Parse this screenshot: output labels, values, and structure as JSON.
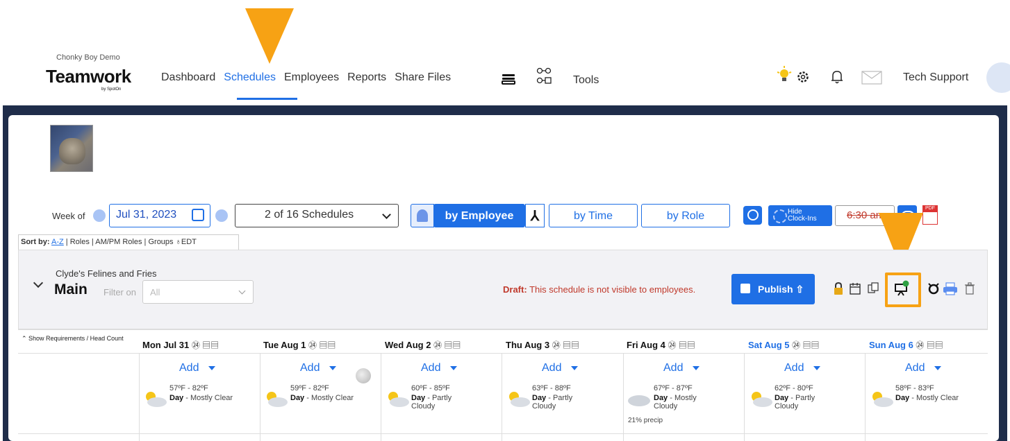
{
  "header": {
    "company": "Chonky Boy Demo",
    "brand": "Teamwork",
    "brand_sub": "by SpotOn",
    "nav": [
      "Dashboard",
      "Schedules",
      "Employees",
      "Reports",
      "Share Files"
    ],
    "active_nav": "Schedules",
    "tools_label": "Tools",
    "user_label": "Tech Support",
    "accent_color": "#1f6fe5",
    "highlight_color": "#f7a214"
  },
  "toolbar": {
    "week_of_label": "Week of",
    "week_date": "Jul 31, 2023",
    "schedules_select": "2 of 16 Schedules",
    "by_employee": "by Employee",
    "by_time": "by Time",
    "by_role": "by Role",
    "hide_clockins_line1": "Hide",
    "hide_clockins_line2": "Clock-Ins",
    "time_value": "6:30 am"
  },
  "sortbar": {
    "sort_by": "Sort by:",
    "options": [
      "A-Z",
      "Roles",
      "AM/PM Roles",
      "Groups"
    ],
    "timezone": "EDT"
  },
  "group": {
    "location": "Clyde's Felines and Fries",
    "title": "Main",
    "filter_label": "Filter on",
    "filter_value": "All",
    "draft_label": "Draft:",
    "draft_message": "This schedule is not visible to employees.",
    "publish_label": "Publish"
  },
  "grid": {
    "requirements_label": "Show Requirements / Head Count",
    "add_label": "Add",
    "day_label": "Day",
    "days": [
      {
        "label": "Mon Jul 31",
        "temp": "57ºF - 82ºF",
        "desc": "Mostly Clear",
        "weekend": false
      },
      {
        "label": "Tue Aug 1",
        "temp": "59ºF - 82ºF",
        "desc": "Mostly Clear",
        "weekend": false
      },
      {
        "label": "Wed Aug 2",
        "temp": "60ºF - 85ºF",
        "desc": "Partly Cloudy",
        "weekend": false
      },
      {
        "label": "Thu Aug 3",
        "temp": "63ºF - 88ºF",
        "desc": "Partly Cloudy",
        "weekend": false
      },
      {
        "label": "Fri Aug 4",
        "temp": "67ºF - 87ºF",
        "desc": "Mostly Cloudy",
        "precip": "21% precip",
        "weekend": false
      },
      {
        "label": "Sat Aug 5",
        "temp": "62ºF - 80ºF",
        "desc": "Partly Cloudy",
        "weekend": true
      },
      {
        "label": "Sun Aug 6",
        "temp": "58ºF - 83ºF",
        "desc": "Mostly Clear",
        "weekend": true
      }
    ]
  }
}
